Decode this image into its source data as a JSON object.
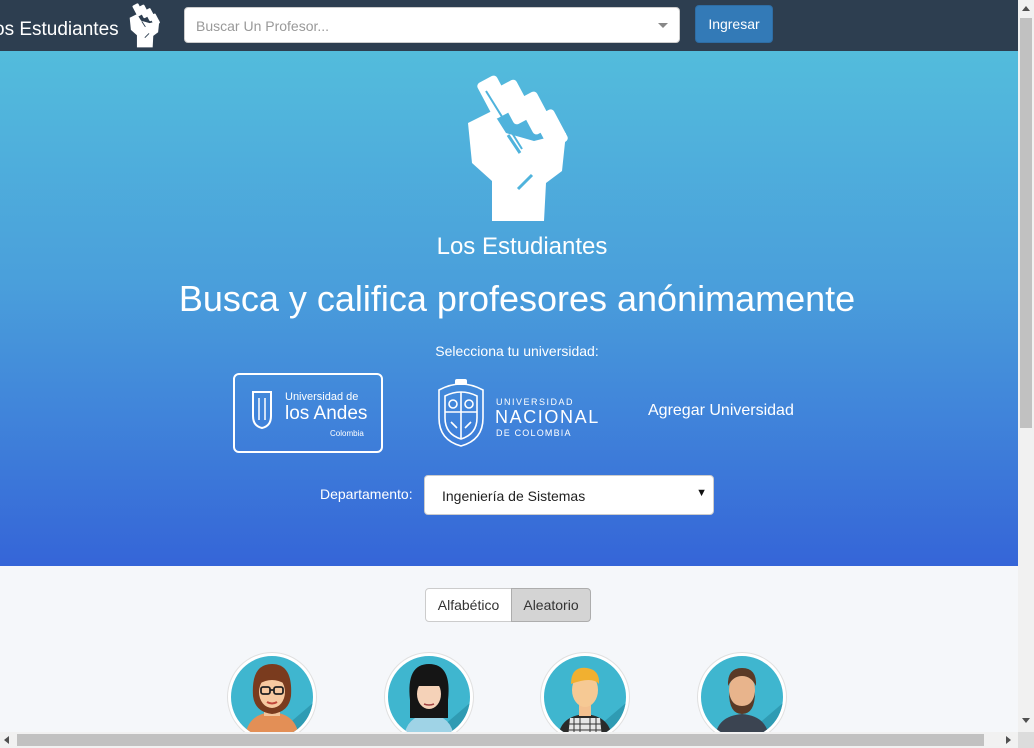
{
  "navbar": {
    "brand": "os Estudiantes",
    "brand_icon": "raised-fist-icon",
    "search_placeholder": "Buscar Un Profesor...",
    "login_label": "Ingresar"
  },
  "hero": {
    "logo_icon": "raised-fist-icon",
    "brand": "Los Estudiantes",
    "title": "Busca y califica profesores anónimamente",
    "select_university_label": "Selecciona tu universidad:",
    "universities": [
      {
        "line1": "Universidad de",
        "line2": "los Andes",
        "line3": "Colombia"
      },
      {
        "line1": "UNIVERSIDAD",
        "line2": "NACIONAL",
        "line3": "DE COLOMBIA"
      }
    ],
    "add_university_label": "Agregar Universidad",
    "department_label": "Departamento:",
    "department_value": "Ingeniería de Sistemas"
  },
  "sort": {
    "options": [
      "Alfabético",
      "Aleatorio"
    ],
    "active": "Aleatorio"
  },
  "colors": {
    "navbar": "#2d3e50",
    "hero_top": "#53bcdc",
    "hero_bottom": "#3565d8",
    "primary_button": "#337ab7",
    "avatar_bg": "#3fb6cf"
  }
}
